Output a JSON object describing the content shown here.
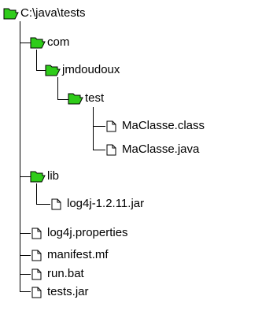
{
  "tree": {
    "root": {
      "label": "C:\\java\\tests",
      "icon": "folder-open-icon"
    },
    "com": {
      "label": "com",
      "icon": "folder-open-icon"
    },
    "jmdoudoux": {
      "label": "jmdoudoux",
      "icon": "folder-open-icon"
    },
    "test": {
      "label": "test",
      "icon": "folder-open-icon"
    },
    "maclasse_class": {
      "label": "MaClasse.class",
      "icon": "file-icon"
    },
    "maclasse_java": {
      "label": "MaClasse.java",
      "icon": "file-icon"
    },
    "lib": {
      "label": "lib",
      "icon": "folder-open-icon"
    },
    "log4j_jar": {
      "label": "log4j-1.2.11.jar",
      "icon": "file-icon"
    },
    "log4j_properties": {
      "label": "log4j.properties",
      "icon": "file-icon"
    },
    "manifest": {
      "label": "manifest.mf",
      "icon": "file-icon"
    },
    "run_bat": {
      "label": "run.bat",
      "icon": "file-icon"
    },
    "tests_jar": {
      "label": "tests.jar",
      "icon": "file-icon"
    }
  },
  "colors": {
    "folder_fill": "#2fcc1a",
    "folder_outline": "#000000",
    "file_fill": "#ffffff",
    "connector_line": "#000000"
  }
}
